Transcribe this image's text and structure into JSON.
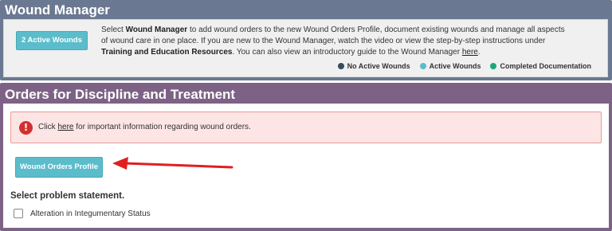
{
  "wound_manager": {
    "title": "Wound Manager",
    "active_button_label": "2 Active Wounds",
    "description": {
      "p1": "Select ",
      "b1": "Wound Manager",
      "p2": " to add wound orders to the new Wound Orders Profile, document existing wounds and manage all aspects of wound care in one place. If you are new to the Wound Manager, watch the video or view the step-by-step instructions under ",
      "b2": "Training and Education Resources",
      "p3": ". You can also view an introductory guide to the Wound Manager ",
      "link": "here",
      "p4": "."
    },
    "legend": [
      {
        "label": "No Active Wounds",
        "color": "#3a4a5e"
      },
      {
        "label": "Active Wounds",
        "color": "#5bbccb"
      },
      {
        "label": "Completed Documentation",
        "color": "#1aa67e"
      }
    ]
  },
  "orders": {
    "title": "Orders for Discipline and Treatment",
    "alert": {
      "icon": "exclamation-icon",
      "prefix": "Click ",
      "link": "here",
      "suffix": " for important information regarding wound orders."
    },
    "profile_button_label": "Wound Orders Profile",
    "problem_statement_label": "Select problem statement.",
    "problem_options": [
      {
        "label": "Alteration in Integumentary Status",
        "checked": false
      }
    ]
  },
  "colors": {
    "wound_manager_header": "#6b7891",
    "orders_header": "#7d6286",
    "button": "#5bbccb",
    "alert_bg": "#fde5e5",
    "alert_icon": "#d32f2f",
    "arrow": "#e02020"
  }
}
